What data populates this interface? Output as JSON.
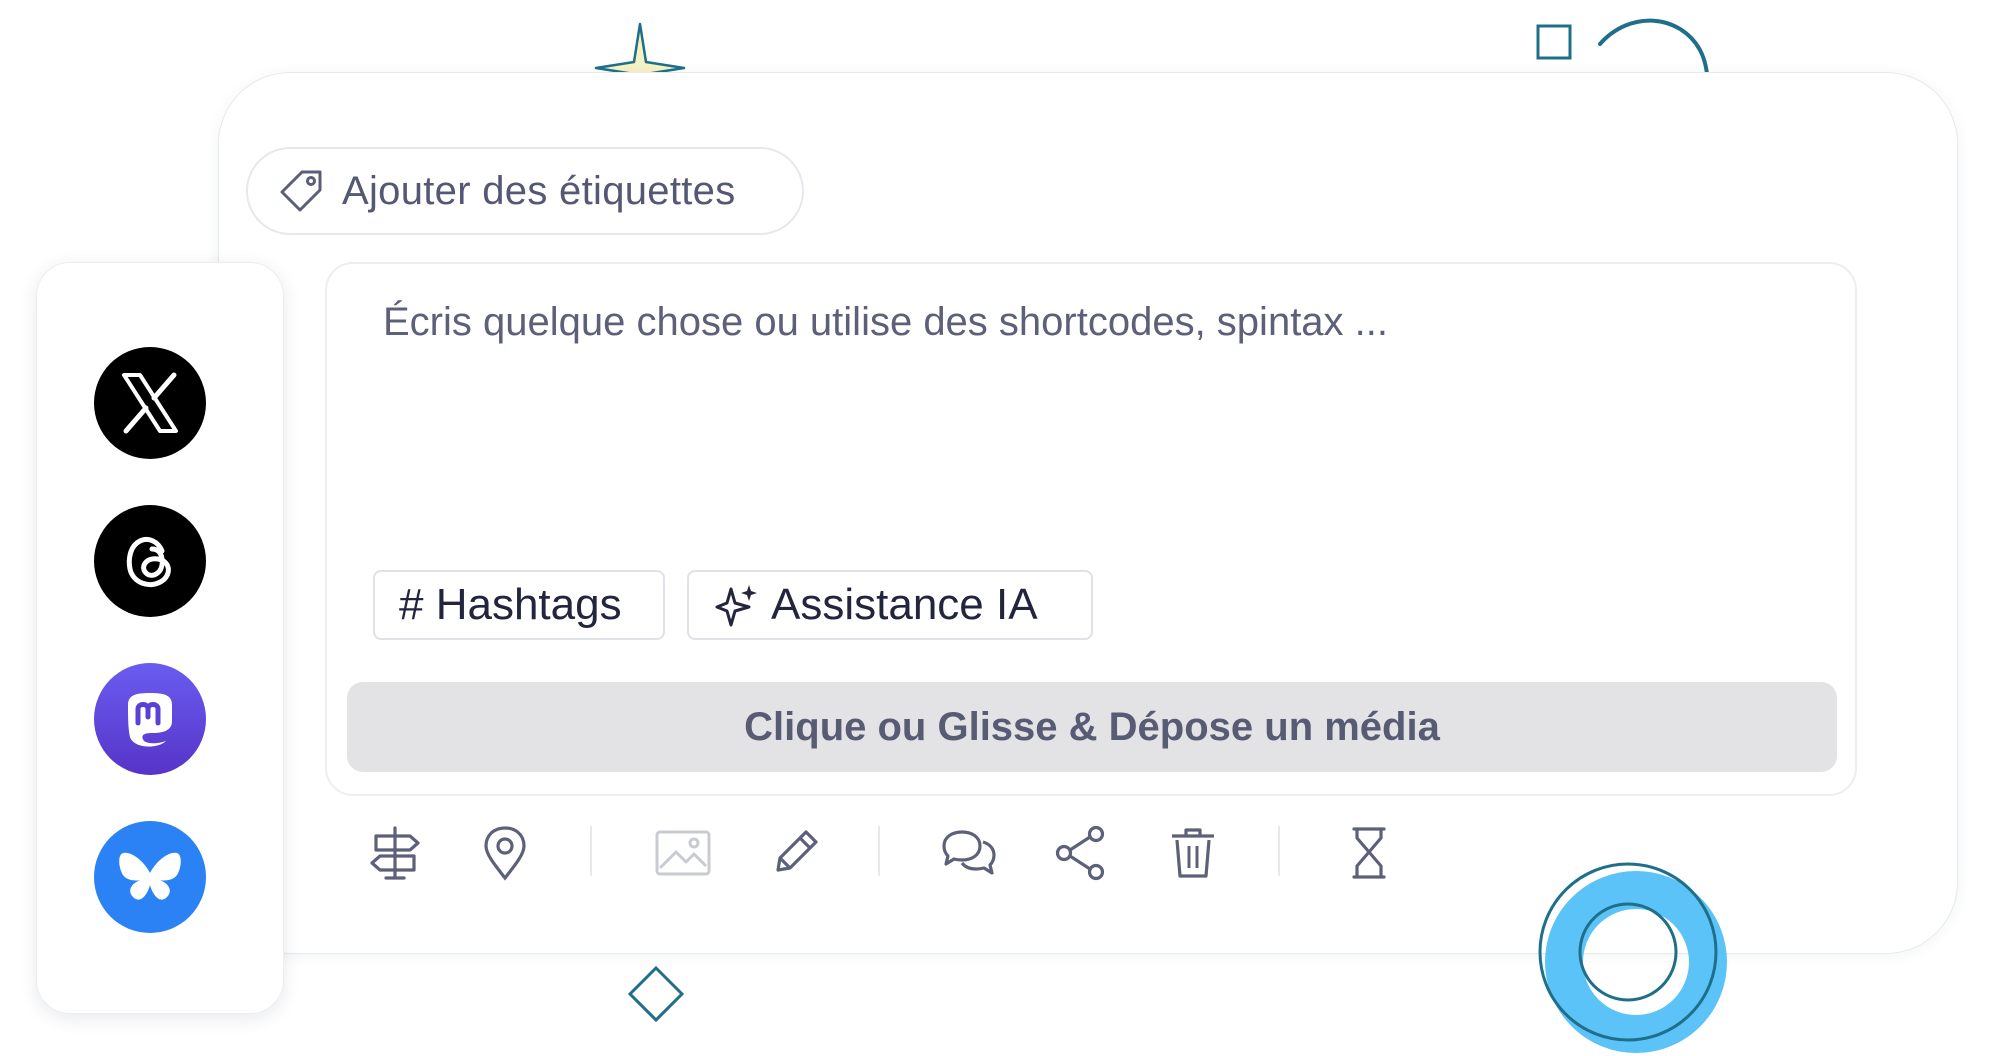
{
  "tags": {
    "label": "Ajouter des étiquettes"
  },
  "networks": [
    {
      "name": "X",
      "icon": "x-icon",
      "color": "#000000"
    },
    {
      "name": "Threads",
      "icon": "threads-icon",
      "color": "#000000"
    },
    {
      "name": "Mastodon",
      "icon": "mastodon-icon",
      "color": "#6046e0"
    },
    {
      "name": "Bluesky",
      "icon": "bluesky-icon",
      "color": "#2b82f5"
    }
  ],
  "editor": {
    "placeholder": "Écris quelque chose ou utilise des shortcodes, spintax ...",
    "value": ""
  },
  "chips": {
    "hashtags": "# Hashtags",
    "ai": "Assistance IA"
  },
  "media": {
    "label": "Clique ou Glisse & Dépose un média"
  },
  "toolbar": {
    "icons": [
      "signpost-icon",
      "location-pin-icon",
      "image-icon",
      "pencil-icon",
      "comments-icon",
      "share-icon",
      "trash-icon",
      "hourglass-icon"
    ]
  },
  "colors": {
    "accent": "#1f6f8b",
    "sparkle": "#f7f2c4",
    "ring": "#5bc3f7",
    "text": "#3f4060",
    "media_bg": "#e3e3e5"
  }
}
